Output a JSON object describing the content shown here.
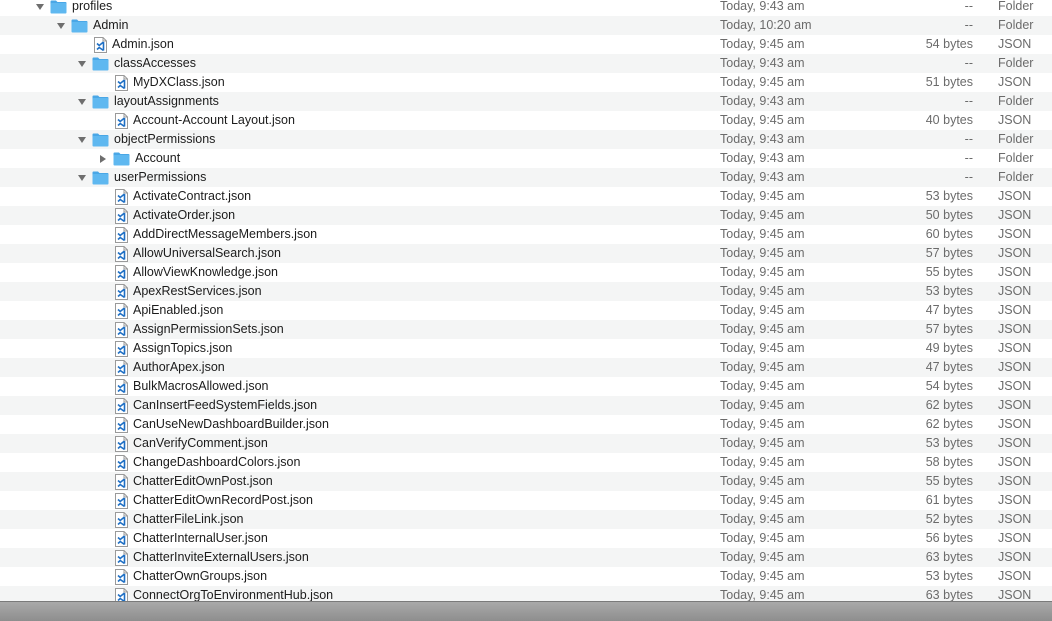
{
  "rows": [
    {
      "name": "profiles",
      "depth": 0,
      "type": "folder",
      "expanded": true,
      "date": "Today, 9:43 am",
      "size": "--",
      "kind": "Folder"
    },
    {
      "name": "Admin",
      "depth": 1,
      "type": "folder",
      "expanded": true,
      "date": "Today, 10:20 am",
      "size": "--",
      "kind": "Folder"
    },
    {
      "name": "Admin.json",
      "depth": 2,
      "type": "file",
      "date": "Today, 9:45 am",
      "size": "54 bytes",
      "kind": "JSON"
    },
    {
      "name": "classAccesses",
      "depth": 2,
      "type": "folder",
      "expanded": true,
      "date": "Today, 9:43 am",
      "size": "--",
      "kind": "Folder"
    },
    {
      "name": "MyDXClass.json",
      "depth": 3,
      "type": "file",
      "date": "Today, 9:45 am",
      "size": "51 bytes",
      "kind": "JSON"
    },
    {
      "name": "layoutAssignments",
      "depth": 2,
      "type": "folder",
      "expanded": true,
      "date": "Today, 9:43 am",
      "size": "--",
      "kind": "Folder"
    },
    {
      "name": "Account-Account Layout.json",
      "depth": 3,
      "type": "file",
      "date": "Today, 9:45 am",
      "size": "40 bytes",
      "kind": "JSON"
    },
    {
      "name": "objectPermissions",
      "depth": 2,
      "type": "folder",
      "expanded": true,
      "date": "Today, 9:43 am",
      "size": "--",
      "kind": "Folder"
    },
    {
      "name": "Account",
      "depth": 3,
      "type": "folder",
      "expanded": false,
      "date": "Today, 9:43 am",
      "size": "--",
      "kind": "Folder"
    },
    {
      "name": "userPermissions",
      "depth": 2,
      "type": "folder",
      "expanded": true,
      "date": "Today, 9:43 am",
      "size": "--",
      "kind": "Folder"
    },
    {
      "name": "ActivateContract.json",
      "depth": 3,
      "type": "file",
      "date": "Today, 9:45 am",
      "size": "53 bytes",
      "kind": "JSON"
    },
    {
      "name": "ActivateOrder.json",
      "depth": 3,
      "type": "file",
      "date": "Today, 9:45 am",
      "size": "50 bytes",
      "kind": "JSON"
    },
    {
      "name": "AddDirectMessageMembers.json",
      "depth": 3,
      "type": "file",
      "date": "Today, 9:45 am",
      "size": "60 bytes",
      "kind": "JSON"
    },
    {
      "name": "AllowUniversalSearch.json",
      "depth": 3,
      "type": "file",
      "date": "Today, 9:45 am",
      "size": "57 bytes",
      "kind": "JSON"
    },
    {
      "name": "AllowViewKnowledge.json",
      "depth": 3,
      "type": "file",
      "date": "Today, 9:45 am",
      "size": "55 bytes",
      "kind": "JSON"
    },
    {
      "name": "ApexRestServices.json",
      "depth": 3,
      "type": "file",
      "date": "Today, 9:45 am",
      "size": "53 bytes",
      "kind": "JSON"
    },
    {
      "name": "ApiEnabled.json",
      "depth": 3,
      "type": "file",
      "date": "Today, 9:45 am",
      "size": "47 bytes",
      "kind": "JSON"
    },
    {
      "name": "AssignPermissionSets.json",
      "depth": 3,
      "type": "file",
      "date": "Today, 9:45 am",
      "size": "57 bytes",
      "kind": "JSON"
    },
    {
      "name": "AssignTopics.json",
      "depth": 3,
      "type": "file",
      "date": "Today, 9:45 am",
      "size": "49 bytes",
      "kind": "JSON"
    },
    {
      "name": "AuthorApex.json",
      "depth": 3,
      "type": "file",
      "date": "Today, 9:45 am",
      "size": "47 bytes",
      "kind": "JSON"
    },
    {
      "name": "BulkMacrosAllowed.json",
      "depth": 3,
      "type": "file",
      "date": "Today, 9:45 am",
      "size": "54 bytes",
      "kind": "JSON"
    },
    {
      "name": "CanInsertFeedSystemFields.json",
      "depth": 3,
      "type": "file",
      "date": "Today, 9:45 am",
      "size": "62 bytes",
      "kind": "JSON"
    },
    {
      "name": "CanUseNewDashboardBuilder.json",
      "depth": 3,
      "type": "file",
      "date": "Today, 9:45 am",
      "size": "62 bytes",
      "kind": "JSON"
    },
    {
      "name": "CanVerifyComment.json",
      "depth": 3,
      "type": "file",
      "date": "Today, 9:45 am",
      "size": "53 bytes",
      "kind": "JSON"
    },
    {
      "name": "ChangeDashboardColors.json",
      "depth": 3,
      "type": "file",
      "date": "Today, 9:45 am",
      "size": "58 bytes",
      "kind": "JSON"
    },
    {
      "name": "ChatterEditOwnPost.json",
      "depth": 3,
      "type": "file",
      "date": "Today, 9:45 am",
      "size": "55 bytes",
      "kind": "JSON"
    },
    {
      "name": "ChatterEditOwnRecordPost.json",
      "depth": 3,
      "type": "file",
      "date": "Today, 9:45 am",
      "size": "61 bytes",
      "kind": "JSON"
    },
    {
      "name": "ChatterFileLink.json",
      "depth": 3,
      "type": "file",
      "date": "Today, 9:45 am",
      "size": "52 bytes",
      "kind": "JSON"
    },
    {
      "name": "ChatterInternalUser.json",
      "depth": 3,
      "type": "file",
      "date": "Today, 9:45 am",
      "size": "56 bytes",
      "kind": "JSON"
    },
    {
      "name": "ChatterInviteExternalUsers.json",
      "depth": 3,
      "type": "file",
      "date": "Today, 9:45 am",
      "size": "63 bytes",
      "kind": "JSON"
    },
    {
      "name": "ChatterOwnGroups.json",
      "depth": 3,
      "type": "file",
      "date": "Today, 9:45 am",
      "size": "53 bytes",
      "kind": "JSON"
    },
    {
      "name": "ConnectOrgToEnvironmentHub.json",
      "depth": 3,
      "type": "file",
      "date": "Today, 9:45 am",
      "size": "63 bytes",
      "kind": "JSON"
    }
  ],
  "colors": {
    "folder": "#5fb8f0",
    "folder_tab": "#4aa7e6",
    "file_accent": "#1f6fc4",
    "alt_row": "#f4f5f5",
    "secondary_text": "#6b6b6b"
  }
}
